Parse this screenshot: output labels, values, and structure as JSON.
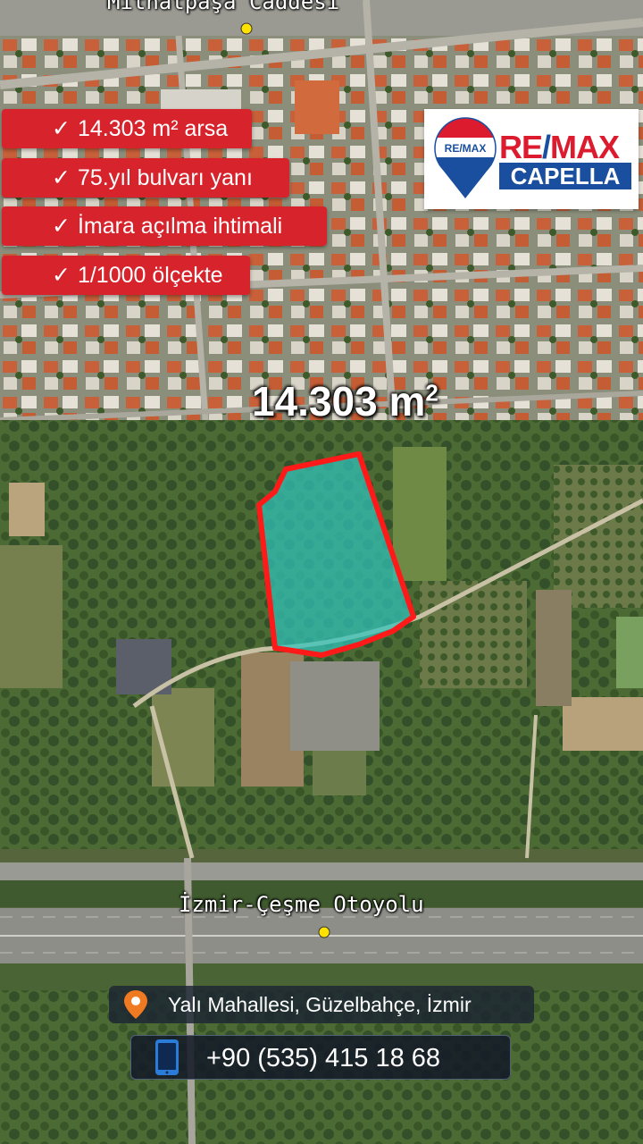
{
  "map": {
    "road_top": "Mithatpaşa Caddesi",
    "road_bottom": "İzmir-Çeşme Otoyolu",
    "area_value": "14.303 m",
    "area_sup": "2",
    "parcel_color": "#2fc3bd",
    "parcel_border": "#ff1a1a"
  },
  "features": [
    {
      "text": "14.303 m² arsa"
    },
    {
      "text": "75.yıl bulvarı yanı"
    },
    {
      "text": "İmara açılma ihtimali"
    },
    {
      "text": "1/1000 ölçekte"
    }
  ],
  "feature_check": "✓",
  "logo": {
    "brand_top_a": "RE",
    "brand_top_slash": "/",
    "brand_top_b": "MAX",
    "brand_bottom": "CAPELLA",
    "balloon_text": "RE/MAX",
    "colors": {
      "red": "#dc1c2e",
      "blue": "#1a4fa0"
    }
  },
  "location": {
    "text": "Yalı Mahallesi,  Güzelbahçe,  İzmir",
    "icon": "location-pin-icon"
  },
  "contact": {
    "phone": "+90 (535) 415 18 68",
    "icon": "smartphone-icon"
  },
  "colors": {
    "badge": "#d7232c",
    "pin": "#f07a22",
    "phone_icon": "#2b7bd8"
  }
}
